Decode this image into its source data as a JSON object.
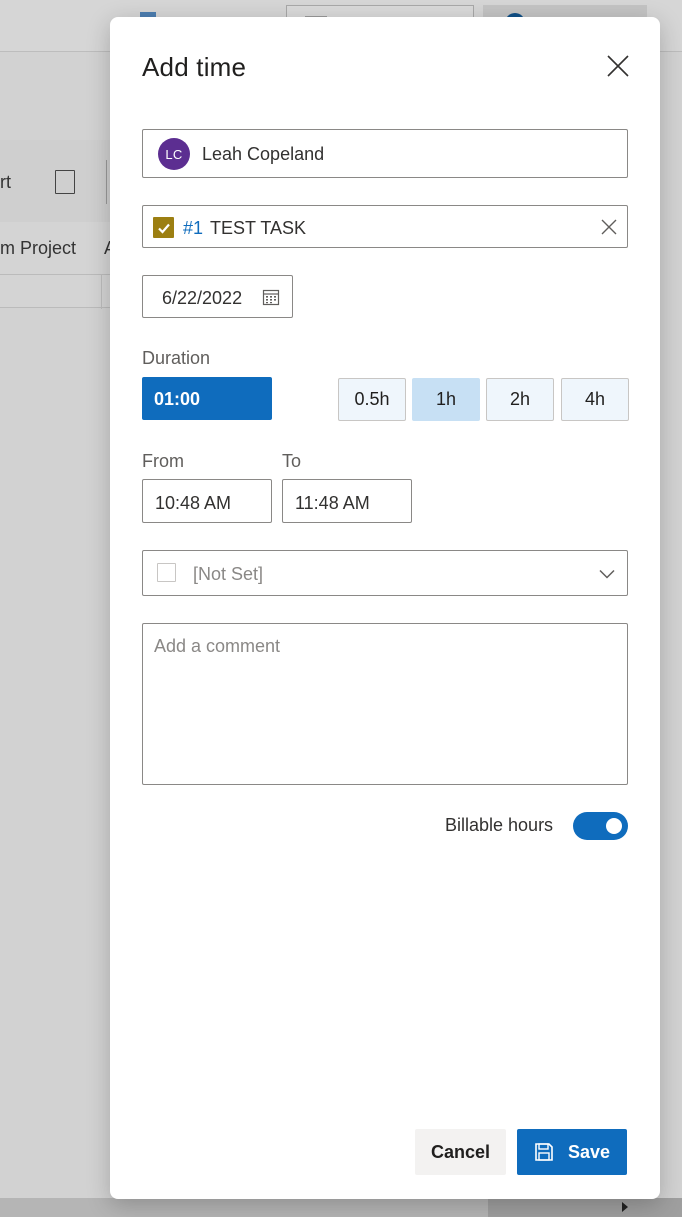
{
  "background": {
    "toolbar_text": "rt",
    "tab_text": "m Project",
    "tab_text2": "A"
  },
  "dialog": {
    "title": "Add time",
    "user": {
      "initials": "LC",
      "name": "Leah Copeland",
      "avatar_color": "#5c2e91"
    },
    "task": {
      "id": "#1",
      "name": "TEST TASK",
      "check_color": "#9c7f12"
    },
    "date": {
      "value": "6/22/2022"
    },
    "duration": {
      "label": "Duration",
      "value": "01:00",
      "presets": [
        {
          "label": "0.5h",
          "active": false
        },
        {
          "label": "1h",
          "active": true
        },
        {
          "label": "2h",
          "active": false
        },
        {
          "label": "4h",
          "active": false
        }
      ]
    },
    "from": {
      "label": "From",
      "value": "10:48 AM"
    },
    "to": {
      "label": "To",
      "value": "11:48 AM"
    },
    "activity": {
      "value": "[Not Set]"
    },
    "comment": {
      "placeholder": "Add a comment",
      "value": ""
    },
    "billable": {
      "label": "Billable hours",
      "on": true
    },
    "buttons": {
      "cancel": "Cancel",
      "save": "Save"
    },
    "accent_color": "#0f6cbd"
  }
}
